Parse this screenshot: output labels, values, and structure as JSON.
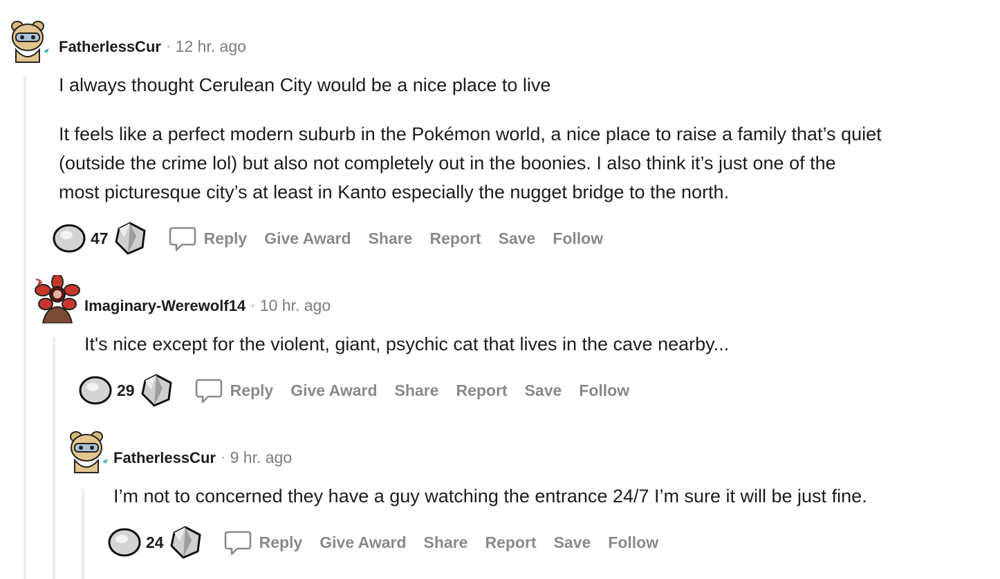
{
  "comments": [
    {
      "username": "FatherlessCur",
      "time": "12 hr. ago",
      "paragraphs": [
        "I always thought Cerulean City would be a nice place to live",
        "It feels like a perfect modern suburb in the Pokémon world, a nice place to raise a family that’s quiet\n(outside the crime lol) but also not completely out in the boonies. I also think it’s just one of the\nmost picturesque city’s at least in Kanto especially the nugget bridge to the north."
      ],
      "score": "47",
      "avatar": "cat-avatar-icon"
    },
    {
      "username": "Imaginary-Werewolf14",
      "time": "10 hr. ago",
      "paragraphs": [
        "It's nice except for the violent, giant, psychic cat that lives in the cave nearby..."
      ],
      "score": "29",
      "avatar": "demogorgon-avatar-icon"
    },
    {
      "username": "FatherlessCur",
      "time": "9 hr. ago",
      "paragraphs": [
        "I’m not to concerned they have a guy watching the entrance 24/7 I’m sure it will be just fine."
      ],
      "score": "24",
      "avatar": "cat-avatar-icon"
    }
  ],
  "actions": {
    "reply": "Reply",
    "give_award": "Give Award",
    "share": "Share",
    "report": "Report",
    "save": "Save",
    "follow": "Follow"
  },
  "separator": "·",
  "colors": {
    "thread_line": "#ededed",
    "muted_text": "#7c7c7c",
    "action_text": "#878a8c",
    "text": "#1c1c1c"
  }
}
